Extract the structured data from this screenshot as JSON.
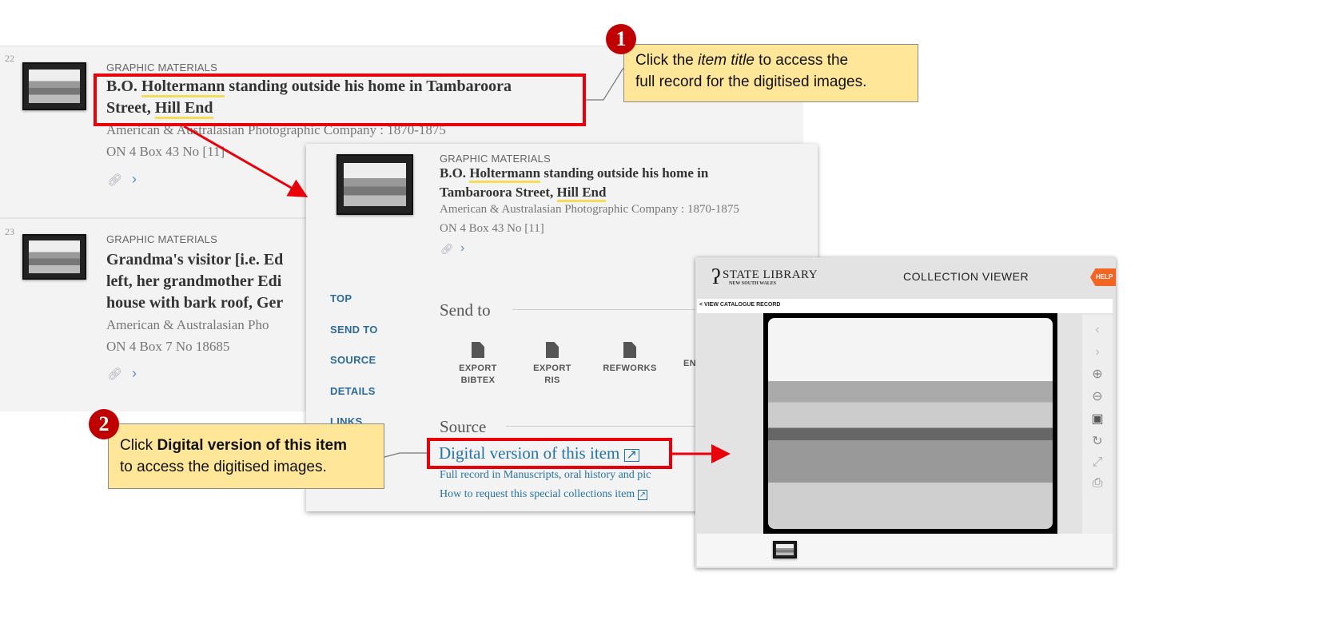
{
  "results": [
    {
      "number": "22",
      "category": "GRAPHIC MATERIALS",
      "title_parts": [
        "B.O. ",
        "Holtermann",
        " standing outside his home in Tambaroora"
      ],
      "title_line2": [
        "Street, ",
        "Hill End"
      ],
      "author": "American & Australasian Photographic Company : 1870-1875",
      "call_number": "ON 4 Box 43 No [11]"
    },
    {
      "number": "23",
      "category": "GRAPHIC MATERIALS",
      "title_lines": [
        "Grandma's visitor [i.e. Ed",
        "left, her grandmother Edi",
        "house with bark roof, Ger"
      ],
      "author": "American & Australasian Pho",
      "call_number": "ON 4 Box 7 No 18685"
    }
  ],
  "detail": {
    "category": "GRAPHIC MATERIALS",
    "title_line1": [
      "B.O. ",
      "Holtermann",
      " standing outside his home in"
    ],
    "title_line2": [
      "Tambaroora Street, ",
      "Hill End"
    ],
    "author": "American & Australasian Photographic Company : 1870-1875",
    "call_number": "ON 4 Box 43 No [11]",
    "nav": [
      "TOP",
      "SEND TO",
      "SOURCE",
      "DETAILS",
      "LINKS"
    ],
    "send_to_heading": "Send to",
    "send_to_items": [
      [
        "EXPORT",
        "BIBTEX"
      ],
      [
        "EXPORT",
        "RIS"
      ],
      [
        "REFWORKS",
        ""
      ],
      [
        "EN",
        ""
      ]
    ],
    "source_heading": "Source",
    "source_links": [
      "Digital version of this item",
      "Full record in Manuscripts, oral history and pic",
      "How to request this special collections item"
    ]
  },
  "viewer": {
    "logo_title": "STATE LIBRARY",
    "logo_subtitle": "NEW SOUTH WALES",
    "heading": "COLLECTION VIEWER",
    "help": "HELP",
    "back_link": "< VIEW CATALOGUE RECORD"
  },
  "callouts": [
    {
      "badge": "1",
      "parts": [
        "Click the ",
        "item title",
        " to access the"
      ],
      "line2": "full record for the digitised images."
    },
    {
      "badge": "2",
      "parts": [
        "Click ",
        "Digital version of this item"
      ],
      "line2": "to access the digitised images."
    }
  ],
  "colors": {
    "highlight_box": "#e8000b",
    "callout_bg": "#ffe699",
    "badge": "#c00000",
    "link": "#2673a8",
    "nav": "#2c6a9c",
    "help": "#f26522"
  }
}
